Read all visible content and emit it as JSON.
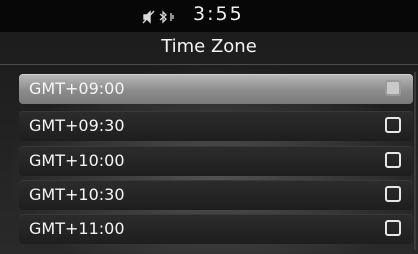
{
  "statusbar": {
    "time": "3:55",
    "icons": [
      "mute-icon",
      "bluetooth-icon"
    ]
  },
  "header": {
    "title": "Time Zone"
  },
  "timezones": [
    {
      "label": "GMT+09:00",
      "selected": true
    },
    {
      "label": "GMT+09:30",
      "selected": false
    },
    {
      "label": "GMT+10:00",
      "selected": false
    },
    {
      "label": "GMT+10:30",
      "selected": false
    },
    {
      "label": "GMT+11:00",
      "selected": false
    }
  ],
  "colors": {
    "statusbar_bg": "#070707",
    "selected_row": "#9c9c9c",
    "row_bg": "#262626",
    "text": "#f4f4f4"
  }
}
